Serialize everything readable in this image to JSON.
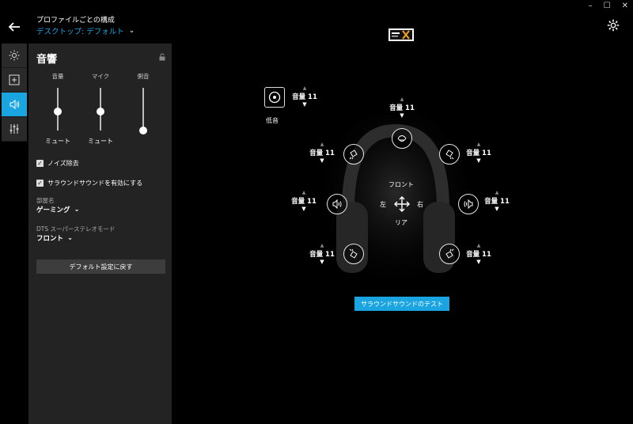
{
  "header": {
    "title": "プロファイルごとの構成",
    "profile": "デスクトップ: デフォルト",
    "window_controls": [
      "–",
      "☐",
      "✕"
    ]
  },
  "panel": {
    "title": "音響",
    "sliders": [
      {
        "label": "音量",
        "value": 0.55,
        "status": "ミュート"
      },
      {
        "label": "マイク",
        "value": 0.55,
        "status": "ミュート"
      },
      {
        "label": "側音",
        "value": 1.0,
        "status": ""
      }
    ],
    "noise_reduction": {
      "label": "ノイズ除去",
      "checked": true
    },
    "surround": {
      "label": "サラウンドサウンドを有効にする",
      "checked": true
    },
    "room": {
      "label": "部屋名",
      "value": "ゲーミング"
    },
    "dts": {
      "label": "DTS スーパーステレオモード",
      "value": "フロント"
    },
    "reset_label": "デフォルト設定に戻す"
  },
  "stage": {
    "lfe_label": "低音",
    "channels": [
      {
        "id": "lfe",
        "volume": "音量 11"
      },
      {
        "id": "center",
        "volume": "音量 11"
      },
      {
        "id": "front-left",
        "volume": "音量 11"
      },
      {
        "id": "front-right",
        "volume": "音量 11"
      },
      {
        "id": "side-left",
        "volume": "音量 11"
      },
      {
        "id": "side-right",
        "volume": "音量 11"
      },
      {
        "id": "rear-left",
        "volume": "音量 11"
      },
      {
        "id": "rear-right",
        "volume": "音量 11"
      }
    ],
    "front": "フロント",
    "rear": "リア",
    "left": "左",
    "right": "右",
    "test_label": "サラウンドサウンドのテスト"
  },
  "colors": {
    "accent": "#1ba5e0",
    "panel": "#232323",
    "background": "#000000"
  }
}
